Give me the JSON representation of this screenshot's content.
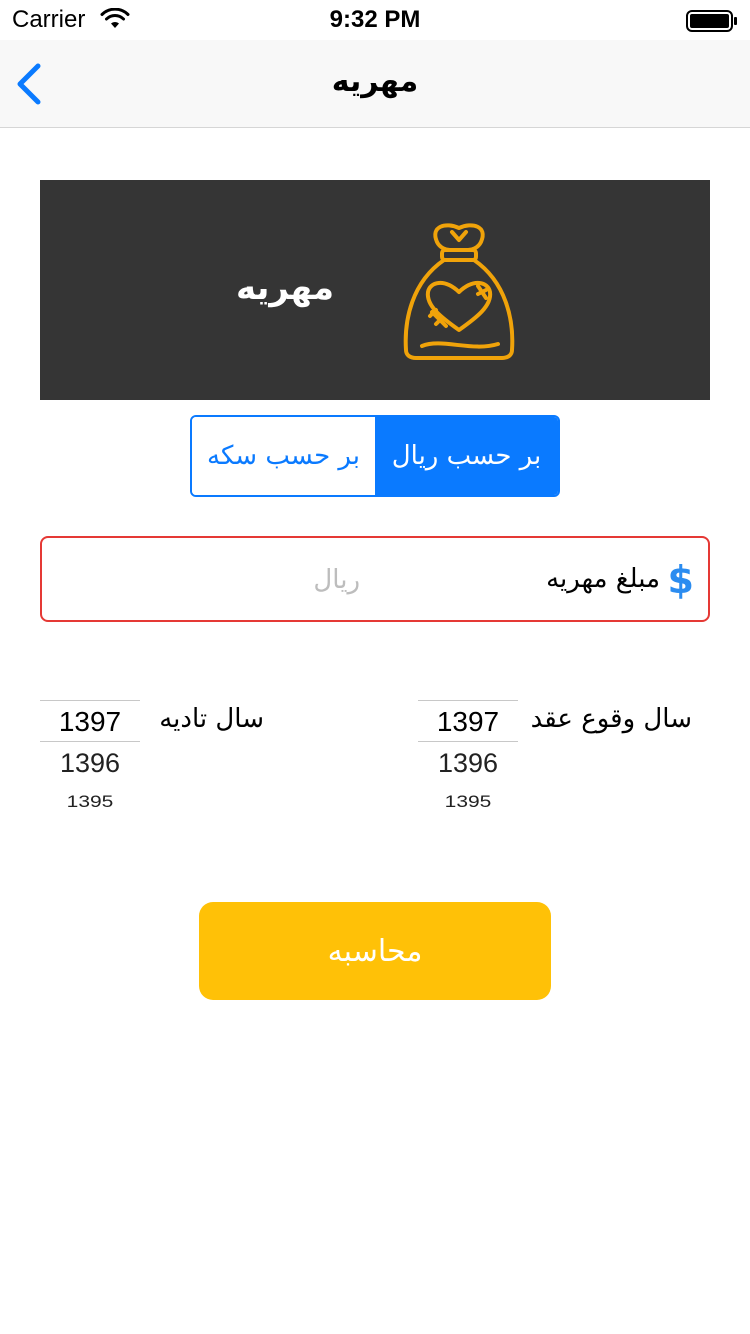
{
  "status_bar": {
    "carrier": "Carrier",
    "time": "9:32 PM"
  },
  "nav": {
    "title": "مهریه",
    "back_icon": "chevron-left-icon"
  },
  "banner": {
    "title": "مهریه",
    "icon": "money-bag-heart-icon",
    "background": "#353535",
    "icon_color": "#f0a30a"
  },
  "segment": {
    "by_coin": "بر حسب سکه",
    "by_rial": "بر حسب ریال",
    "selected": "by_rial",
    "accent": "#0a7aff"
  },
  "amount": {
    "label": "مبلغ مهریه",
    "placeholder": "ریال",
    "value": "",
    "icon": "dollar-icon",
    "border_color": "#e53935"
  },
  "contract_year": {
    "label": "سال وقوع عقد",
    "options": [
      "1397",
      "1396",
      "1395"
    ],
    "selected": "1397"
  },
  "payment_year": {
    "label": "سال تادیه",
    "options": [
      "1397",
      "1396",
      "1395"
    ],
    "selected": "1397"
  },
  "calculate": {
    "label": "محاسبه",
    "color": "#ffc107"
  }
}
